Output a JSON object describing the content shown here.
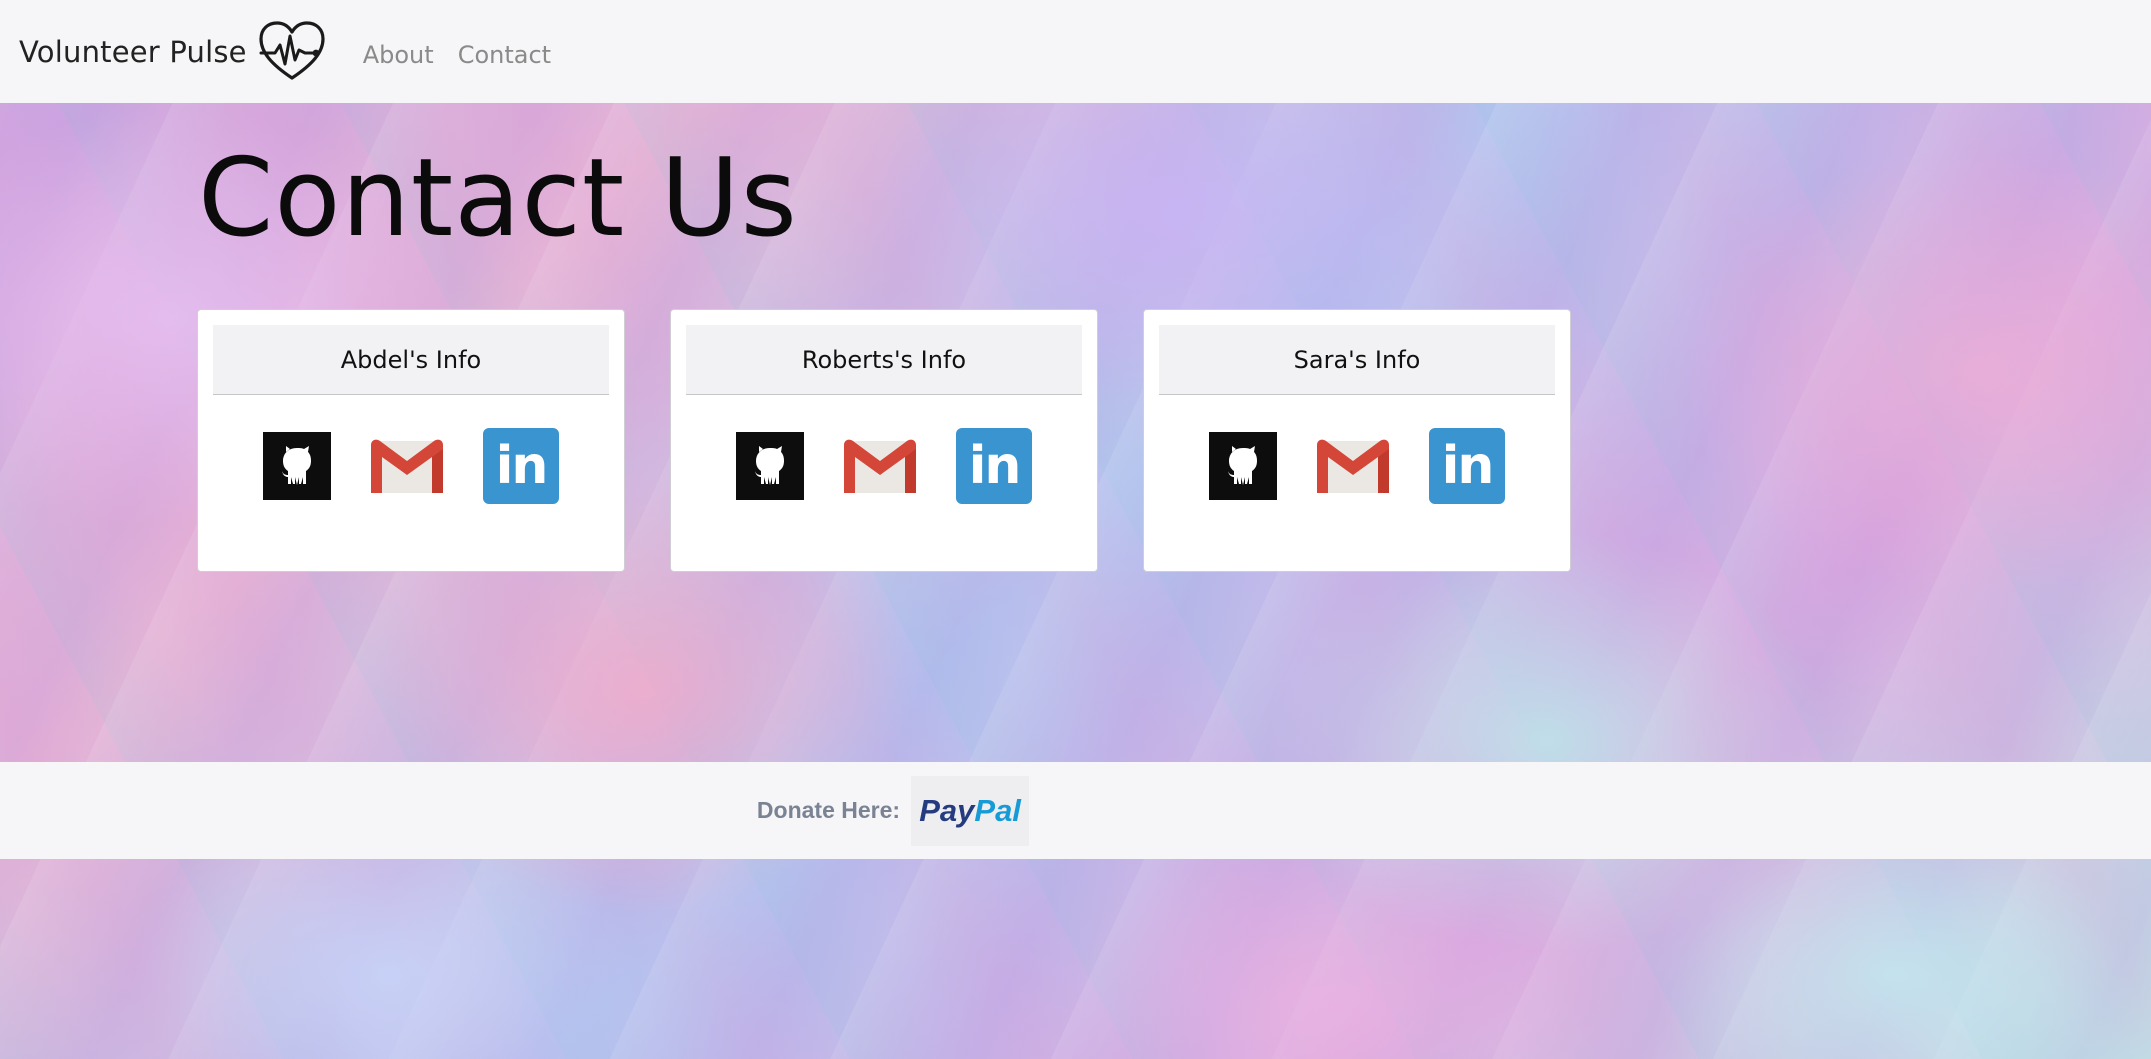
{
  "navbar": {
    "brand": "Volunteer Pulse",
    "brand_logo_icon": "heartbeat-icon",
    "links": [
      {
        "label": "About"
      },
      {
        "label": "Contact"
      }
    ]
  },
  "page": {
    "title": "Contact Us"
  },
  "cards": [
    {
      "header": "Abdel's Info",
      "icons": [
        "github-icon",
        "gmail-icon",
        "linkedin-icon"
      ]
    },
    {
      "header": "Roberts's Info",
      "icons": [
        "github-icon",
        "gmail-icon",
        "linkedin-icon"
      ]
    },
    {
      "header": "Sara's Info",
      "icons": [
        "github-icon",
        "gmail-icon",
        "linkedin-icon"
      ]
    }
  ],
  "footer": {
    "donate_label": "Donate Here:",
    "paypal_part1": "Pay",
    "paypal_part2": "Pal"
  },
  "colors": {
    "navbar_bg": "#f6f5f7",
    "linkedin": "#3a94cf",
    "github": "#0d0d0d",
    "gmail_red": "#d44638",
    "paypal_dark": "#253b80",
    "paypal_light": "#179bd7"
  },
  "linkedin_text": "in"
}
